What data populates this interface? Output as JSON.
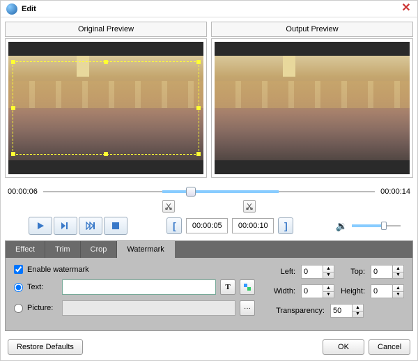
{
  "window": {
    "title": "Edit"
  },
  "preview": {
    "original_label": "Original Preview",
    "output_label": "Output Preview"
  },
  "timeline": {
    "current": "00:00:06",
    "total": "00:00:14",
    "in_time": "00:00:05",
    "out_time": "00:00:10",
    "playhead_pct": 43,
    "sel_start_pct": 36,
    "sel_end_pct": 71
  },
  "volume": {
    "level_pct": 60
  },
  "tabs": {
    "items": [
      {
        "label": "Effect"
      },
      {
        "label": "Trim"
      },
      {
        "label": "Crop"
      },
      {
        "label": "Watermark"
      }
    ],
    "active": 3
  },
  "watermark": {
    "enable_label": "Enable watermark",
    "enabled": true,
    "mode": "text",
    "text_label": "Text:",
    "text_value": "",
    "picture_label": "Picture:",
    "picture_value": "",
    "left_label": "Left:",
    "left": 0,
    "top_label": "Top:",
    "top": 0,
    "width_label": "Width:",
    "width": 0,
    "height_label": "Height:",
    "height": 0,
    "transparency_label": "Transparency:",
    "transparency": 50
  },
  "footer": {
    "restore": "Restore Defaults",
    "ok": "OK",
    "cancel": "Cancel"
  }
}
